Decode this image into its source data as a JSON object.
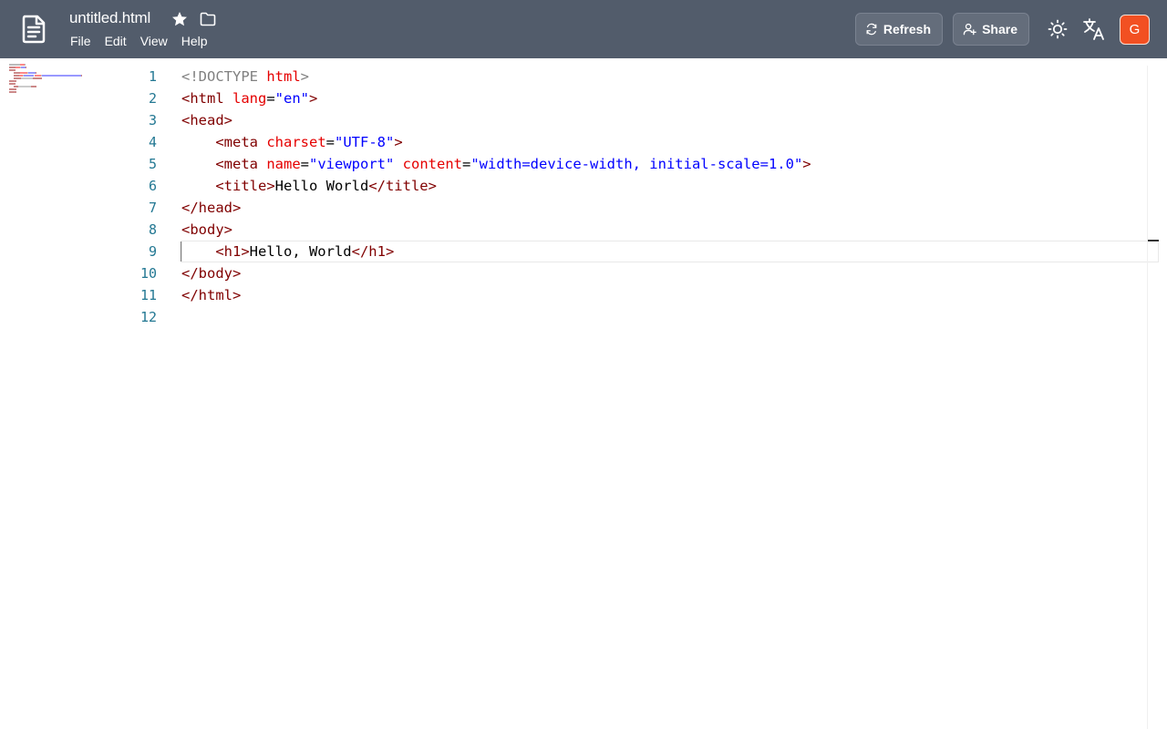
{
  "header": {
    "file_name": "untitled.html",
    "menu": [
      "File",
      "Edit",
      "View",
      "Help"
    ],
    "refresh_label": "Refresh",
    "share_label": "Share",
    "avatar_initial": "G"
  },
  "editor": {
    "line_numbers": [
      "1",
      "2",
      "3",
      "4",
      "5",
      "6",
      "7",
      "8",
      "9",
      "10",
      "11",
      "12"
    ],
    "current_line": 9,
    "colors": {
      "tag": "#800000",
      "attribute": "#e50000",
      "value": "#0000ff",
      "doctype": "#808080",
      "line_number": "#237893",
      "topbar": "#525c6b",
      "avatar": "#f25022"
    },
    "lines": [
      [
        {
          "t": "doc",
          "v": "<!DOCTYPE "
        },
        {
          "t": "attr",
          "v": "html"
        },
        {
          "t": "doc",
          "v": ">"
        }
      ],
      [
        {
          "t": "tag",
          "v": "<html "
        },
        {
          "t": "attr",
          "v": "lang"
        },
        {
          "t": "text",
          "v": "="
        },
        {
          "t": "val",
          "v": "\"en\""
        },
        {
          "t": "tag",
          "v": ">"
        }
      ],
      [
        {
          "t": "tag",
          "v": "<head>"
        }
      ],
      [
        {
          "t": "text",
          "v": "    "
        },
        {
          "t": "tag",
          "v": "<meta "
        },
        {
          "t": "attr",
          "v": "charset"
        },
        {
          "t": "text",
          "v": "="
        },
        {
          "t": "val",
          "v": "\"UTF-8\""
        },
        {
          "t": "tag",
          "v": ">"
        }
      ],
      [
        {
          "t": "text",
          "v": "    "
        },
        {
          "t": "tag",
          "v": "<meta "
        },
        {
          "t": "attr",
          "v": "name"
        },
        {
          "t": "text",
          "v": "="
        },
        {
          "t": "val",
          "v": "\"viewport\""
        },
        {
          "t": "text",
          "v": " "
        },
        {
          "t": "attr",
          "v": "content"
        },
        {
          "t": "text",
          "v": "="
        },
        {
          "t": "val",
          "v": "\"width=device-width, initial-scale=1.0\""
        },
        {
          "t": "tag",
          "v": ">"
        }
      ],
      [
        {
          "t": "text",
          "v": "    "
        },
        {
          "t": "tag",
          "v": "<title>"
        },
        {
          "t": "text",
          "v": "Hello World"
        },
        {
          "t": "tag",
          "v": "</title>"
        }
      ],
      [
        {
          "t": "tag",
          "v": "</head>"
        }
      ],
      [
        {
          "t": "tag",
          "v": "<body>"
        }
      ],
      [
        {
          "t": "text",
          "v": "    "
        },
        {
          "t": "tag",
          "v": "<h1>"
        },
        {
          "t": "text",
          "v": "Hello, World"
        },
        {
          "t": "tag",
          "v": "</h1>"
        }
      ],
      [
        {
          "t": "tag",
          "v": "</body>"
        }
      ],
      [
        {
          "t": "tag",
          "v": "</html>"
        }
      ],
      []
    ]
  }
}
